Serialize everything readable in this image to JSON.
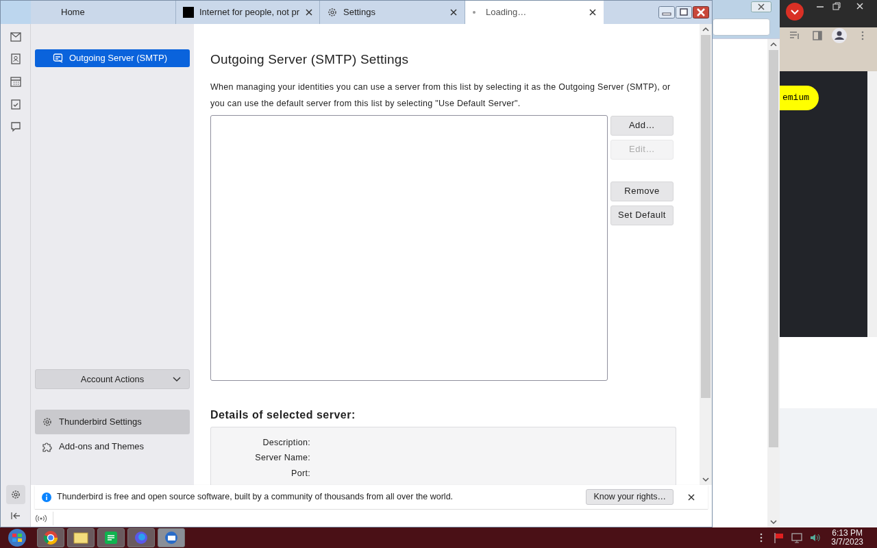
{
  "tabs": [
    {
      "label": "Home",
      "kind": "home",
      "selected": false,
      "closable": false
    },
    {
      "label": "Internet for people, not pr",
      "kind": "site",
      "selected": false,
      "closable": true
    },
    {
      "label": "Settings",
      "kind": "settings",
      "selected": false,
      "closable": true
    },
    {
      "label": "Loading…",
      "kind": "loading",
      "selected": true,
      "closable": true
    }
  ],
  "sidebar": {
    "accounts": [
      {
        "label": "Outgoing Server (SMTP)",
        "selected": true
      }
    ],
    "account_actions": "Account Actions",
    "links": [
      {
        "label": "Thunderbird Settings",
        "kind": "settings",
        "hovered": true
      },
      {
        "label": "Add-ons and Themes",
        "kind": "addons",
        "hovered": false
      }
    ]
  },
  "main": {
    "title": "Outgoing Server (SMTP) Settings",
    "description": "When managing your identities you can use a server from this list by selecting it as the Outgoing Server (SMTP), or you can use the default server from this list by selecting \"Use Default Server\".",
    "buttons": [
      {
        "label": "Add…",
        "disabled": false
      },
      {
        "label": "Edit…",
        "disabled": true
      },
      {
        "label": "Remove",
        "disabled": false
      },
      {
        "label": "Set Default",
        "disabled": false
      }
    ],
    "details_title": "Details of selected server:",
    "detail_fields": [
      "Description:",
      "Server Name:",
      "Port:"
    ]
  },
  "notification": {
    "text": "Thunderbird is free and open source software, built by a community of thousands from all over the world.",
    "button": "Know your rights…"
  },
  "background_window": {
    "pill": "emium"
  },
  "taskbar": {
    "time": "6:13 PM",
    "date": "3/7/2023"
  }
}
